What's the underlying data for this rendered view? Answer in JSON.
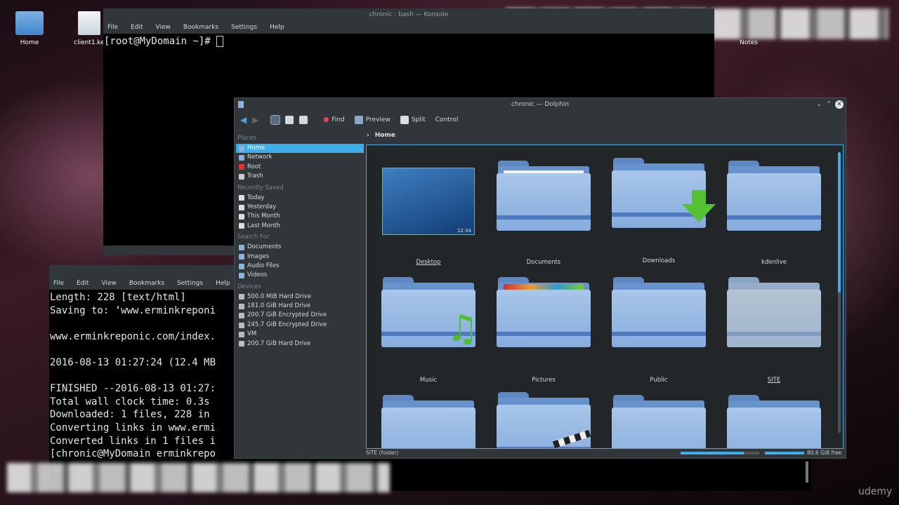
{
  "desktop": {
    "icons": [
      {
        "label": "Home"
      },
      {
        "label": "client1.ke"
      },
      {
        "label": "Notes"
      }
    ]
  },
  "konsole_top": {
    "title": "chronic : bash — Konsole",
    "menu": [
      "File",
      "Edit",
      "View",
      "Bookmarks",
      "Settings",
      "Help"
    ],
    "prompt": "[root@MyDomain ~]# "
  },
  "konsole_bottom": {
    "menu": [
      "File",
      "Edit",
      "View",
      "Bookmarks",
      "Settings",
      "Help"
    ],
    "lines": [
      "Length: 228 [text/html]",
      "Saving to: ‘www.erminkreponi",
      "",
      "www.erminkreponic.com/index.",
      "",
      "2016-08-13 01:27:24 (12.4 MB",
      "",
      "FINISHED --2016-08-13 01:27:",
      "Total wall clock time: 0.3s",
      "Downloaded: 1 files, 228 in",
      "Converting links in www.ermi",
      "Converted links in 1 files i",
      "[chronic@MyDomain erminkrepo"
    ]
  },
  "dolphin": {
    "title": "chronic — Dolphin",
    "toolbar": {
      "find": "Find",
      "preview": "Preview",
      "split": "Split",
      "control": "Control"
    },
    "sidebar": {
      "places_header": "Places",
      "places": [
        "Home",
        "Network",
        "Root",
        "Trash"
      ],
      "recent_header": "Recently Saved",
      "recent": [
        "Today",
        "Yesterday",
        "This Month",
        "Last Month"
      ],
      "search_header": "Search For",
      "search": [
        "Documents",
        "Images",
        "Audio Files",
        "Videos"
      ],
      "devices_header": "Devices",
      "devices": [
        "500.0 MiB Hard Drive",
        "181.0 GiB Hard Drive",
        "200.7 GiB Encrypted Drive",
        "245.7 GiB Encrypted Drive",
        "VM",
        "200.7 GiB Hard Drive"
      ]
    },
    "breadcrumb": "Home",
    "items": [
      "Desktop",
      "Documents",
      "Downloads",
      "kdenlive",
      "Music",
      "Pictures",
      "Public",
      "SITE"
    ],
    "status_left": "SITE (folder)",
    "status_right": "80.6 GiB free",
    "thumb_clock": "12:34"
  },
  "watermark": "udemy",
  "colors": {
    "accent": "#3daee9",
    "folder": "#86abdd",
    "window": "#31363b"
  }
}
